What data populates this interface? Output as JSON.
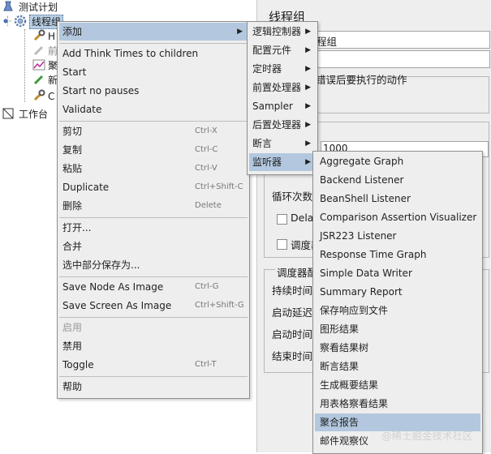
{
  "tree": {
    "test_plan": "测试计划",
    "thread_group": "线程组",
    "child_letters": [
      "H",
      "前",
      "聚",
      "新",
      "C"
    ],
    "workbench": "工作台"
  },
  "right_panel": {
    "title": "线程组",
    "name_value": "程组",
    "error_action_label": "错误后要执行的动作",
    "thread_count_value": "1000",
    "loop_label": "循环次数",
    "delay_label": "Delay",
    "scheduler_label": "调度器",
    "scheduler_config_label": "调度器配",
    "duration_label": "持续时间",
    "startup_delay_label": "启动延迟",
    "start_time_label": "启动时间",
    "end_time_label": "结束时间"
  },
  "context_menu": {
    "add": "添加",
    "add_think_times": "Add Think Times to children",
    "start": "Start",
    "start_no_pauses": "Start no pauses",
    "validate": "Validate",
    "cut": "剪切",
    "cut_sc": "Ctrl-X",
    "copy": "复制",
    "copy_sc": "Ctrl-C",
    "paste": "粘贴",
    "paste_sc": "Ctrl-V",
    "duplicate": "Duplicate",
    "duplicate_sc": "Ctrl+Shift-C",
    "delete": "删除",
    "delete_sc": "Delete",
    "open": "打开...",
    "merge": "合并",
    "save_selection_as": "选中部分保存为...",
    "save_node_image": "Save Node As Image",
    "save_node_image_sc": "Ctrl-G",
    "save_screen_image": "Save Screen As Image",
    "save_screen_image_sc": "Ctrl+Shift-G",
    "enable": "启用",
    "disable": "禁用",
    "toggle": "Toggle",
    "toggle_sc": "Ctrl-T",
    "help": "帮助"
  },
  "add_submenu": {
    "logic_controller": "逻辑控制器",
    "config_element": "配置元件",
    "timer": "定时器",
    "pre_processor": "前置处理器",
    "sampler": "Sampler",
    "post_processor": "后置处理器",
    "assertion": "断言",
    "listener": "监听器"
  },
  "listener_submenu": {
    "items": [
      "Aggregate Graph",
      "Backend Listener",
      "BeanShell Listener",
      "Comparison Assertion Visualizer",
      "JSR223 Listener",
      "Response Time Graph",
      "Simple Data Writer",
      "Summary Report",
      "保存响应到文件",
      "图形结果",
      "察看结果树",
      "断言结果",
      "生成概要结果",
      "用表格察看结果",
      "聚合报告",
      "邮件观察仪"
    ]
  },
  "watermark": "@稀土掘金技术社区",
  "colors": {
    "menu_bg": "#eeeeee",
    "highlight": "#b3c8df",
    "disabled_text": "#9a9a9a"
  }
}
